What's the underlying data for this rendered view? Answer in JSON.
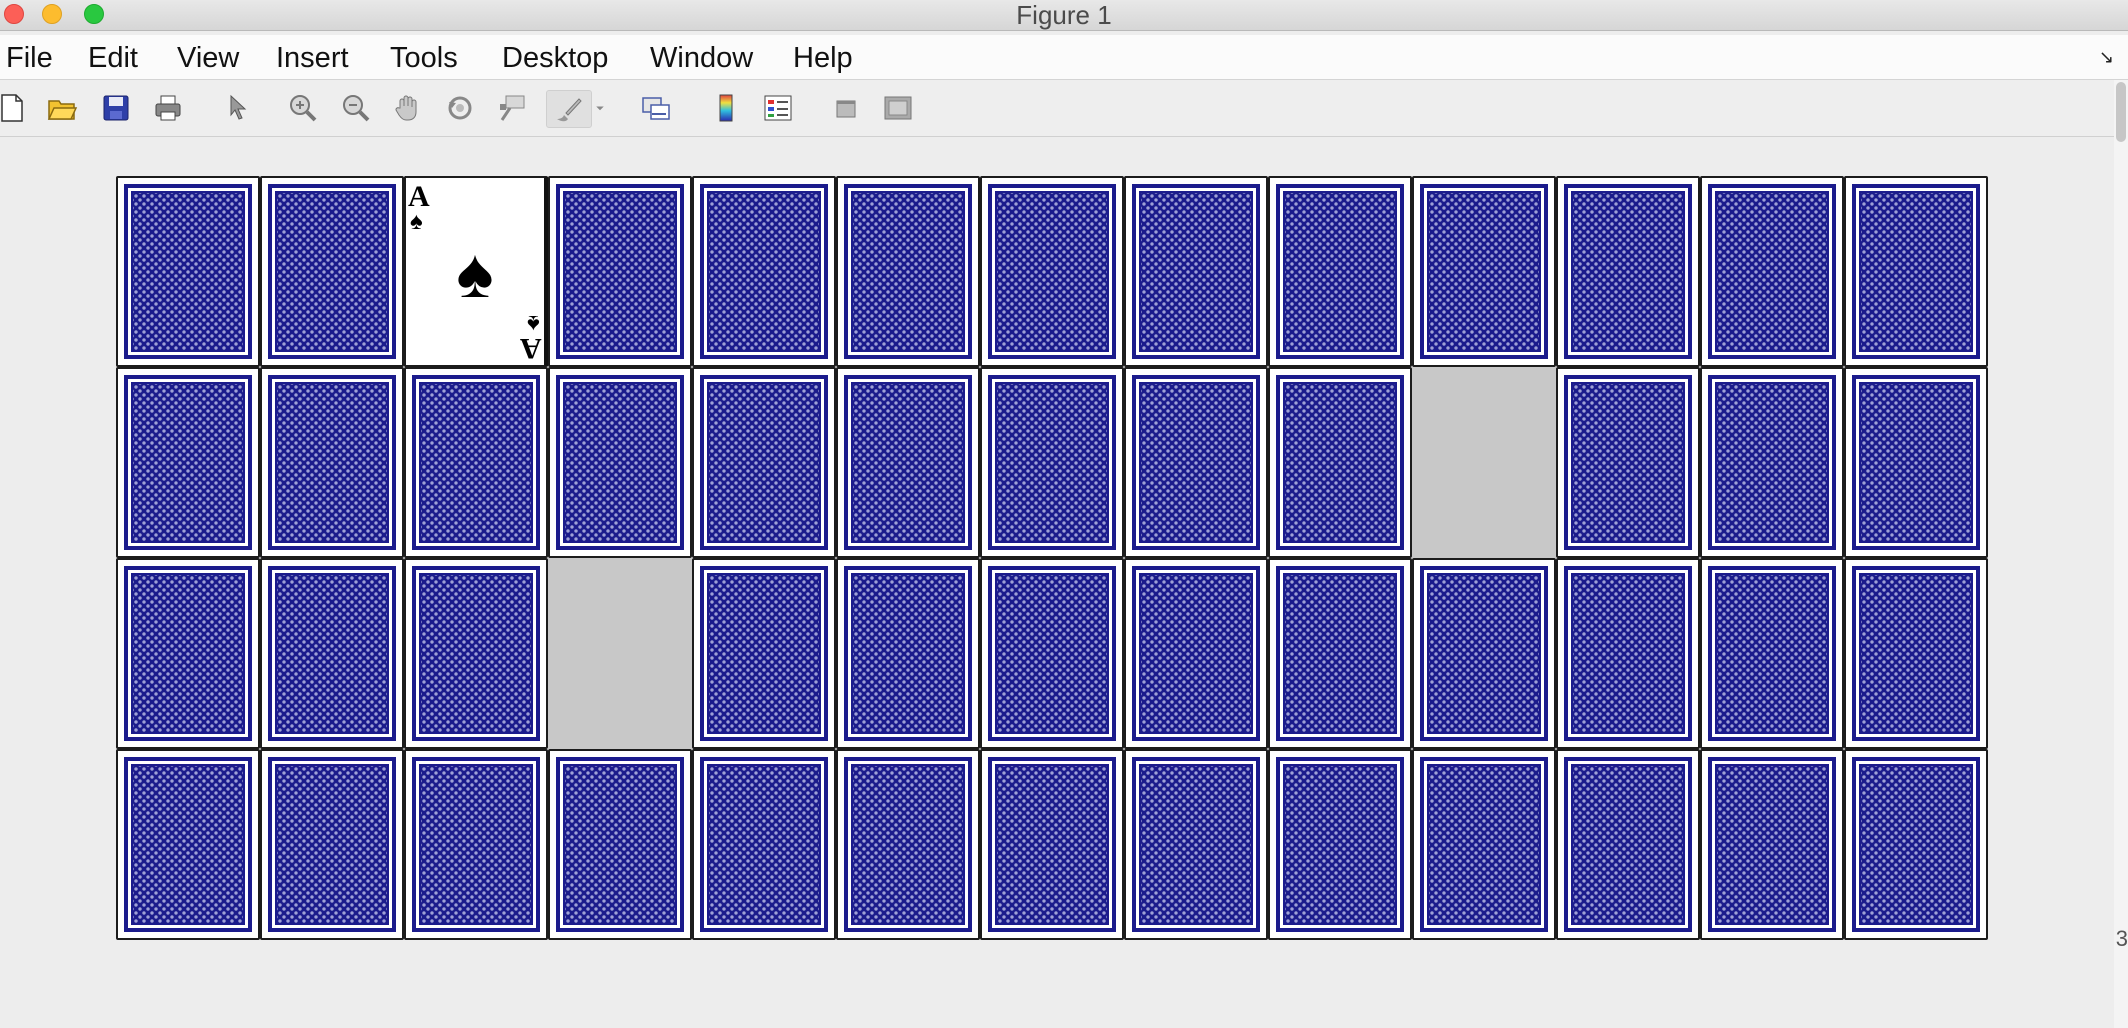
{
  "window": {
    "title": "Figure 1"
  },
  "menu": [
    "File",
    "Edit",
    "View",
    "Insert",
    "Tools",
    "Desktop",
    "Window",
    "Help"
  ],
  "toolbar": [
    {
      "icon": "new-figure-icon"
    },
    {
      "icon": "open-file-icon"
    },
    {
      "icon": "save-icon"
    },
    {
      "icon": "print-icon"
    },
    {
      "icon": "edit-plot-arrow-icon"
    },
    {
      "icon": "zoom-in-icon"
    },
    {
      "icon": "zoom-out-icon"
    },
    {
      "icon": "pan-hand-icon"
    },
    {
      "icon": "rotate-3d-icon"
    },
    {
      "icon": "data-cursor-icon"
    },
    {
      "icon": "brush-icon"
    },
    {
      "icon": "link-plot-icon"
    },
    {
      "icon": "insert-colorbar-icon"
    },
    {
      "icon": "insert-legend-icon"
    },
    {
      "icon": "hide-plot-tools-icon"
    },
    {
      "icon": "show-plot-tools-icon"
    }
  ],
  "board": {
    "rows": 4,
    "cols": 13,
    "colors": {
      "card_back": "#1b1b8c",
      "empty_slot": "#c8c8c8"
    },
    "cells": [
      [
        "back",
        "back",
        "face",
        "back",
        "back",
        "back",
        "back",
        "back",
        "back",
        "back",
        "back",
        "back",
        "back"
      ],
      [
        "back",
        "back",
        "back",
        "back",
        "back",
        "back",
        "back",
        "back",
        "back",
        "empty",
        "back",
        "back",
        "back"
      ],
      [
        "back",
        "back",
        "back",
        "empty",
        "back",
        "back",
        "back",
        "back",
        "back",
        "back",
        "back",
        "back",
        "back"
      ],
      [
        "back",
        "back",
        "back",
        "back",
        "back",
        "back",
        "back",
        "back",
        "back",
        "back",
        "back",
        "back",
        "back"
      ]
    ],
    "face_card": {
      "rank": "A",
      "suit": "♠"
    }
  },
  "edge_text": "3"
}
